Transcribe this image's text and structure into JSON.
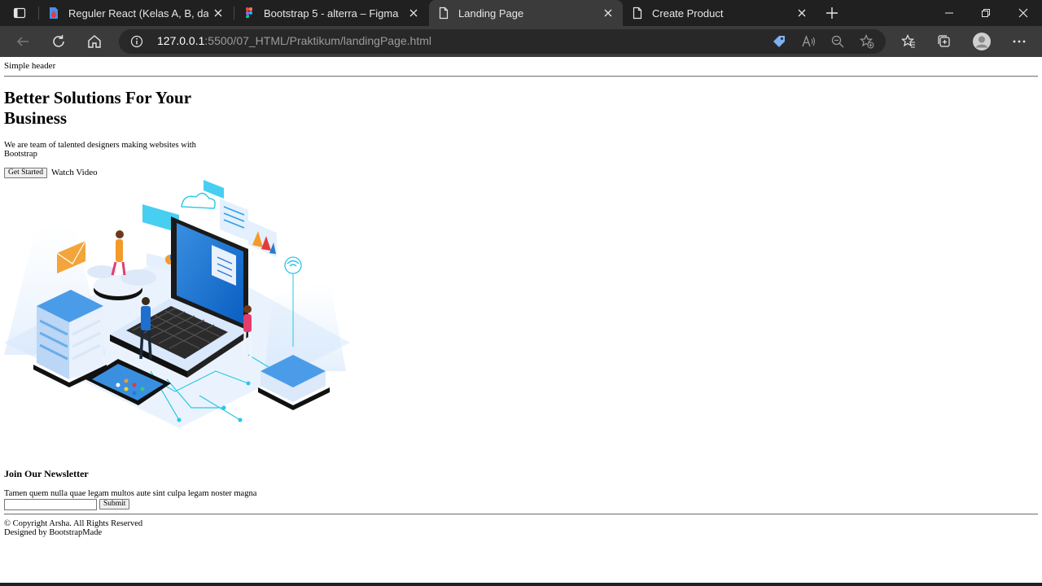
{
  "browser": {
    "tabs": [
      {
        "title": "Reguler React (Kelas A, B, dan C)",
        "icon": "canva-file-icon",
        "active": false
      },
      {
        "title": "Bootstrap 5 - alterra – Figma",
        "icon": "figma-icon",
        "active": false
      },
      {
        "title": "Landing Page",
        "icon": "page-icon",
        "active": true
      },
      {
        "title": "Create Product",
        "icon": "page-icon",
        "active": false
      }
    ],
    "url_host": "127.0.0.1",
    "url_path": ":5500/07_HTML/Praktikum/landingPage.html",
    "colors": {
      "frame": "#202020",
      "toolbar": "#3b3b3b",
      "omnibox": "#282828",
      "accent_tag": "#7fb0f0"
    }
  },
  "page": {
    "header": "Simple header",
    "hero": {
      "title": "Better Solutions For Your Business",
      "description": "We are team of talented designers making websites with Bootstrap",
      "cta_label": "Get Started",
      "video_label": "Watch Video"
    },
    "newsletter": {
      "title": "Join Our Newsletter",
      "description": "Tamen quem nulla quae legam multos aute sint culpa legam noster magna",
      "input_value": "",
      "submit_label": "Submit"
    },
    "footer": {
      "copyright": "© Copyright Arsha. All Rights Reserved",
      "credit": "Designed by BootstrapMade"
    }
  }
}
